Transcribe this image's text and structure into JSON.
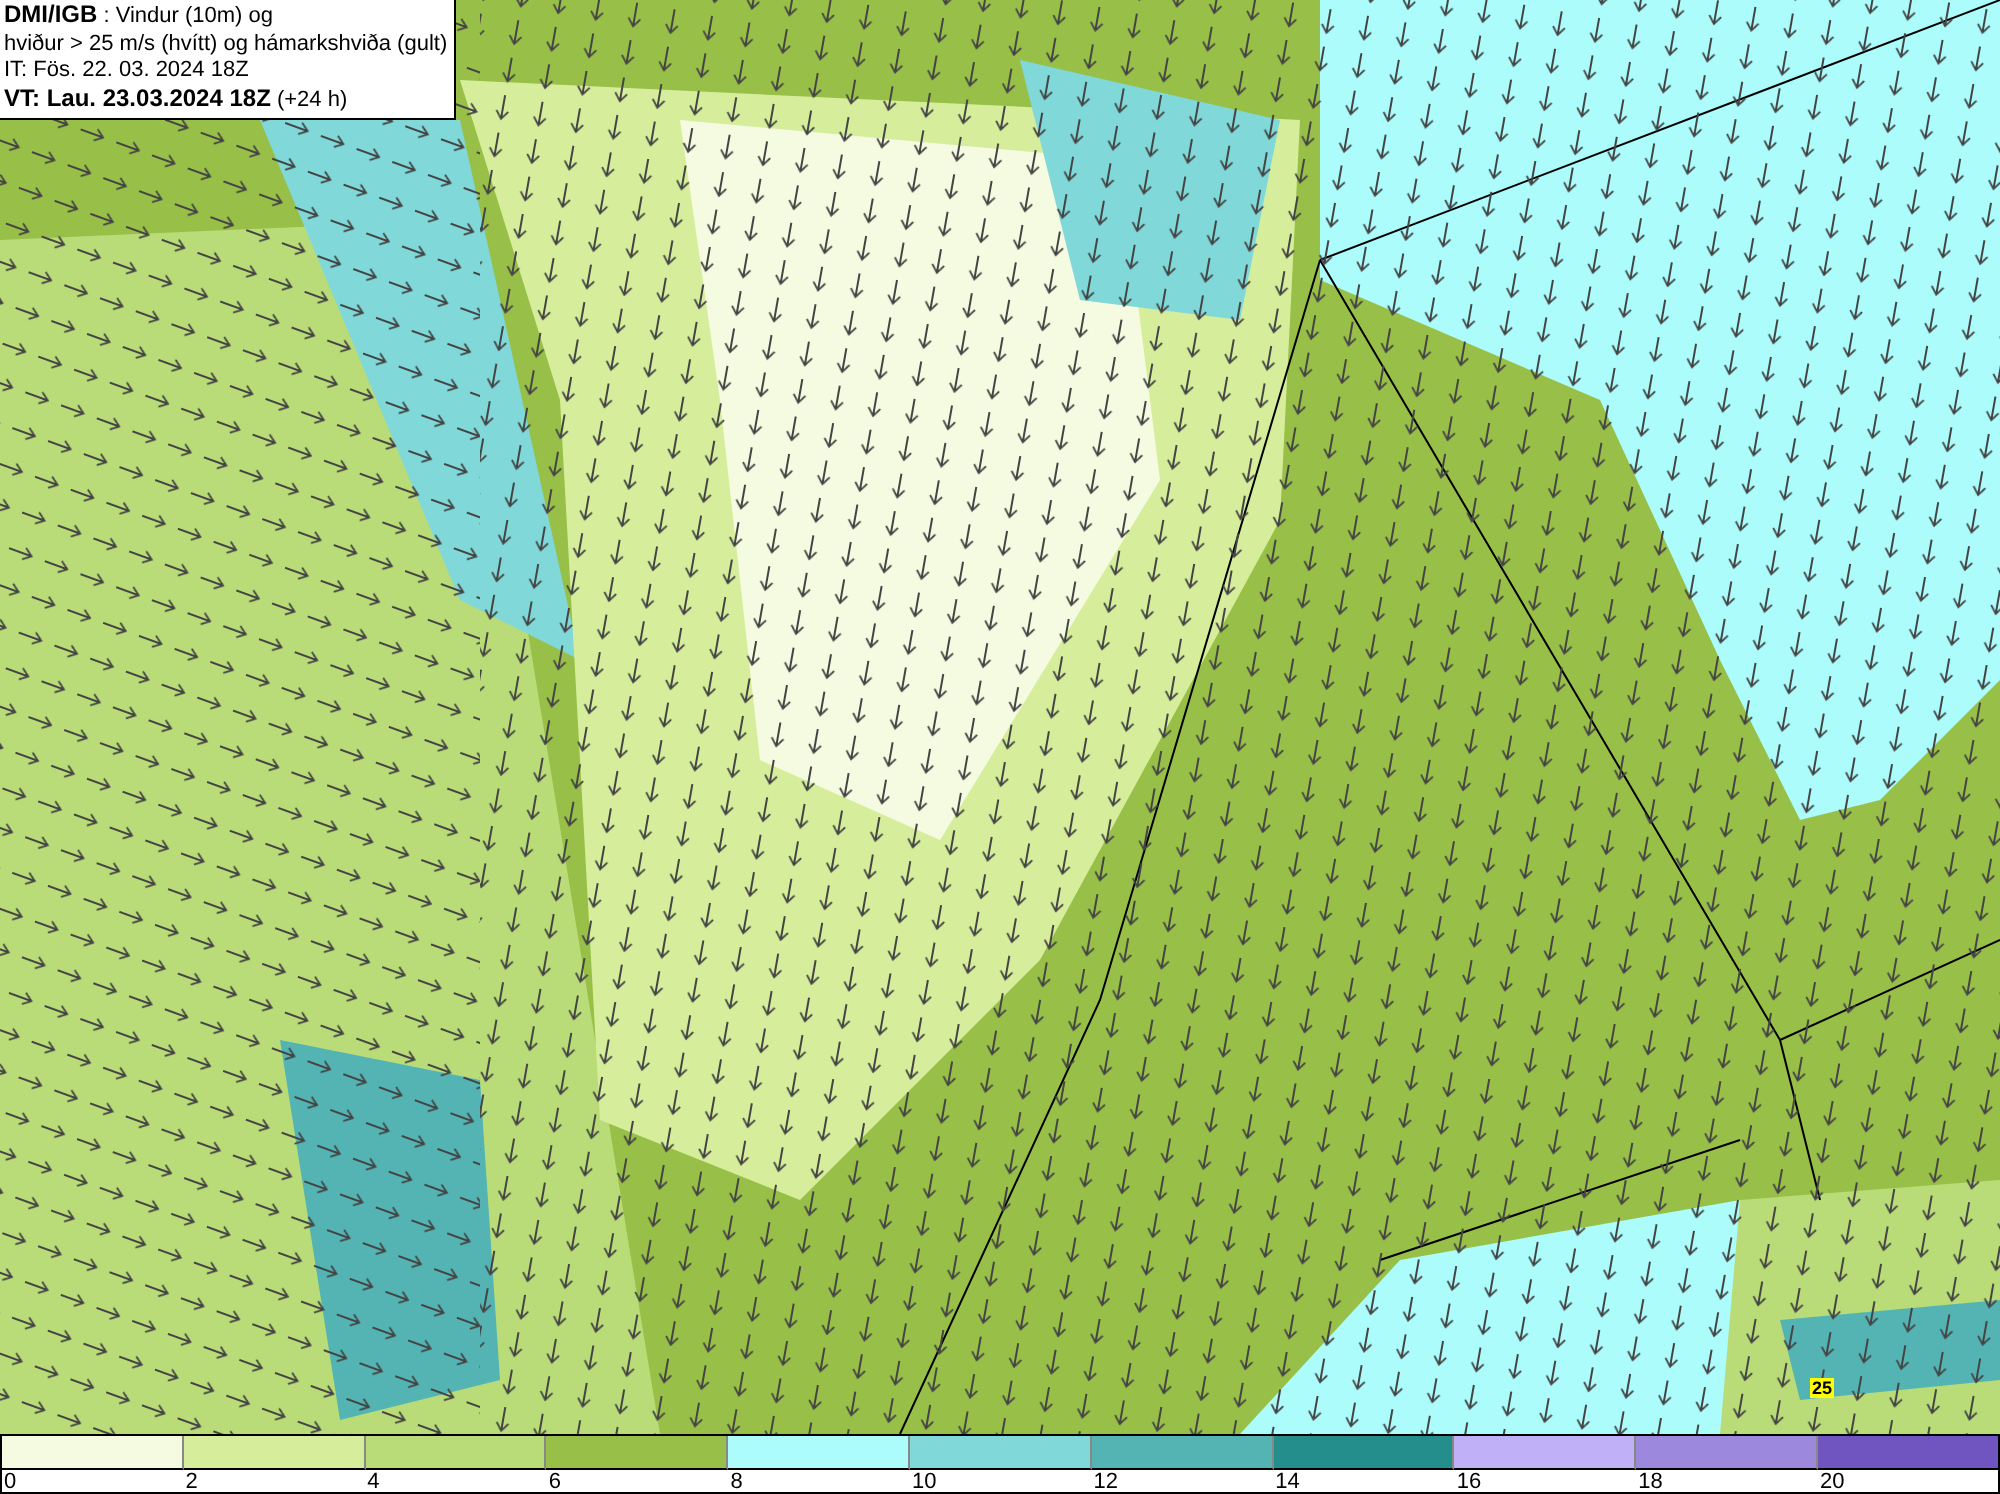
{
  "header": {
    "lines": [
      "**DMI/IGB** : Vindur (10m) og",
      "hviður > 25 m/s (hvítt) og hámarkshviða (gult)",
      "IT: Fös. 22. 03. 2024 18Z",
      "**VT: Lau. 23.03.2024 18Z** (+24 h)"
    ]
  },
  "map": {
    "gust_labels": [
      {
        "text": "25"
      }
    ]
  },
  "legend": [
    {
      "label": "0",
      "color": "#f5fbe0"
    },
    {
      "label": "2",
      "color": "#d6ee9c"
    },
    {
      "label": "4",
      "color": "#b9dc78"
    },
    {
      "label": "6",
      "color": "#98c048"
    },
    {
      "label": "8",
      "color": "#acfcfc"
    },
    {
      "label": "10",
      "color": "#80d8d8"
    },
    {
      "label": "12",
      "color": "#54b4b4"
    },
    {
      "label": "14",
      "color": "#248e8c"
    },
    {
      "label": "16",
      "color": "#c0b0f8"
    },
    {
      "label": "18",
      "color": "#9c88dc"
    },
    {
      "label": "20",
      "color": "#7054c0"
    }
  ]
}
